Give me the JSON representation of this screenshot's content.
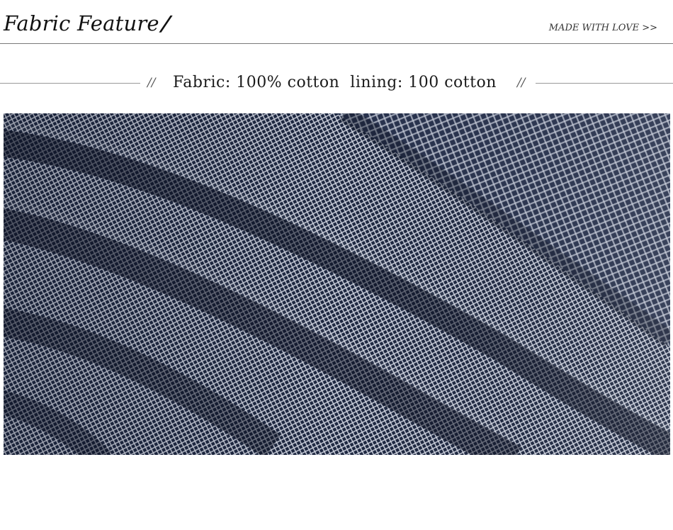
{
  "header": {
    "title": "Fabric Feature",
    "title_mark": "/",
    "tagline": "MADE WITH LOVE >>"
  },
  "spec": {
    "left_mark": "//",
    "text": "Fabric: 100% cotton  lining: 100 cotton",
    "right_mark": "//"
  },
  "photo": {
    "subject": "navy-white-check-fabric-closeup",
    "colors": {
      "base": "#1d2740",
      "check": "#d8dce6",
      "shadow": "#0b1020"
    }
  }
}
